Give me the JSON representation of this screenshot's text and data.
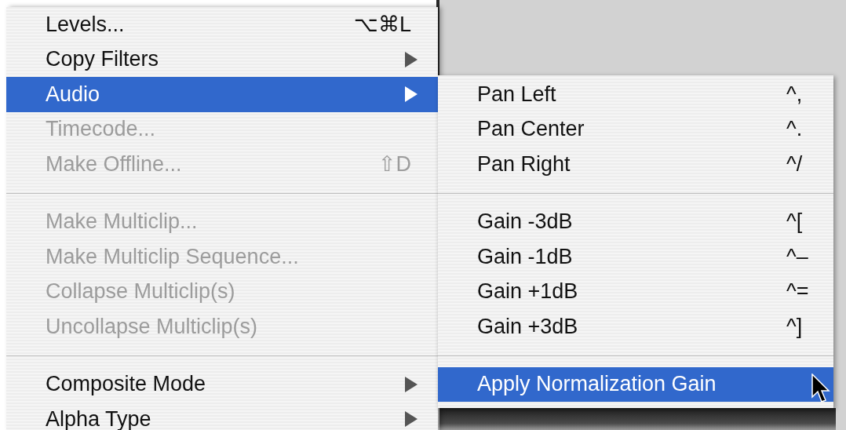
{
  "menu": {
    "items": [
      {
        "kind": "item",
        "label": "Levels...",
        "shortcut": "⌥⌘L",
        "submenu": false,
        "disabled": false,
        "selected": false
      },
      {
        "kind": "item",
        "label": "Copy Filters",
        "submenu": true,
        "disabled": false,
        "selected": false
      },
      {
        "kind": "item",
        "label": "Audio",
        "submenu": true,
        "disabled": false,
        "selected": true
      },
      {
        "kind": "item",
        "label": "Timecode...",
        "submenu": false,
        "disabled": true,
        "selected": false
      },
      {
        "kind": "item",
        "label": "Make Offline...",
        "shortcut": "⇧D",
        "submenu": false,
        "disabled": true,
        "selected": false
      },
      {
        "kind": "separator"
      },
      {
        "kind": "item",
        "label": "Make Multiclip...",
        "submenu": false,
        "disabled": true,
        "selected": false
      },
      {
        "kind": "item",
        "label": "Make Multiclip Sequence...",
        "submenu": false,
        "disabled": true,
        "selected": false
      },
      {
        "kind": "item",
        "label": "Collapse Multiclip(s)",
        "submenu": false,
        "disabled": true,
        "selected": false
      },
      {
        "kind": "item",
        "label": "Uncollapse Multiclip(s)",
        "submenu": false,
        "disabled": true,
        "selected": false
      },
      {
        "kind": "separator"
      },
      {
        "kind": "item",
        "label": "Composite Mode",
        "submenu": true,
        "disabled": false,
        "selected": false
      },
      {
        "kind": "item",
        "label": "Alpha Type",
        "submenu": true,
        "disabled": false,
        "selected": false
      }
    ]
  },
  "submenu": {
    "items": [
      {
        "kind": "item",
        "label": "Pan Left",
        "shortcut": "^,",
        "submenu": false,
        "disabled": false,
        "selected": false
      },
      {
        "kind": "item",
        "label": "Pan Center",
        "shortcut": "^.",
        "submenu": false,
        "disabled": false,
        "selected": false
      },
      {
        "kind": "item",
        "label": "Pan Right",
        "shortcut": "^/",
        "submenu": false,
        "disabled": false,
        "selected": false
      },
      {
        "kind": "separator"
      },
      {
        "kind": "item",
        "label": "Gain -3dB",
        "shortcut": "^[",
        "submenu": false,
        "disabled": false,
        "selected": false
      },
      {
        "kind": "item",
        "label": "Gain -1dB",
        "shortcut": "^–",
        "submenu": false,
        "disabled": false,
        "selected": false
      },
      {
        "kind": "item",
        "label": "Gain +1dB",
        "shortcut": "^=",
        "submenu": false,
        "disabled": false,
        "selected": false
      },
      {
        "kind": "item",
        "label": "Gain +3dB",
        "shortcut": "^]",
        "submenu": false,
        "disabled": false,
        "selected": false
      },
      {
        "kind": "separator"
      },
      {
        "kind": "item",
        "label": "Apply Normalization Gain",
        "submenu": false,
        "disabled": false,
        "selected": true
      }
    ]
  }
}
